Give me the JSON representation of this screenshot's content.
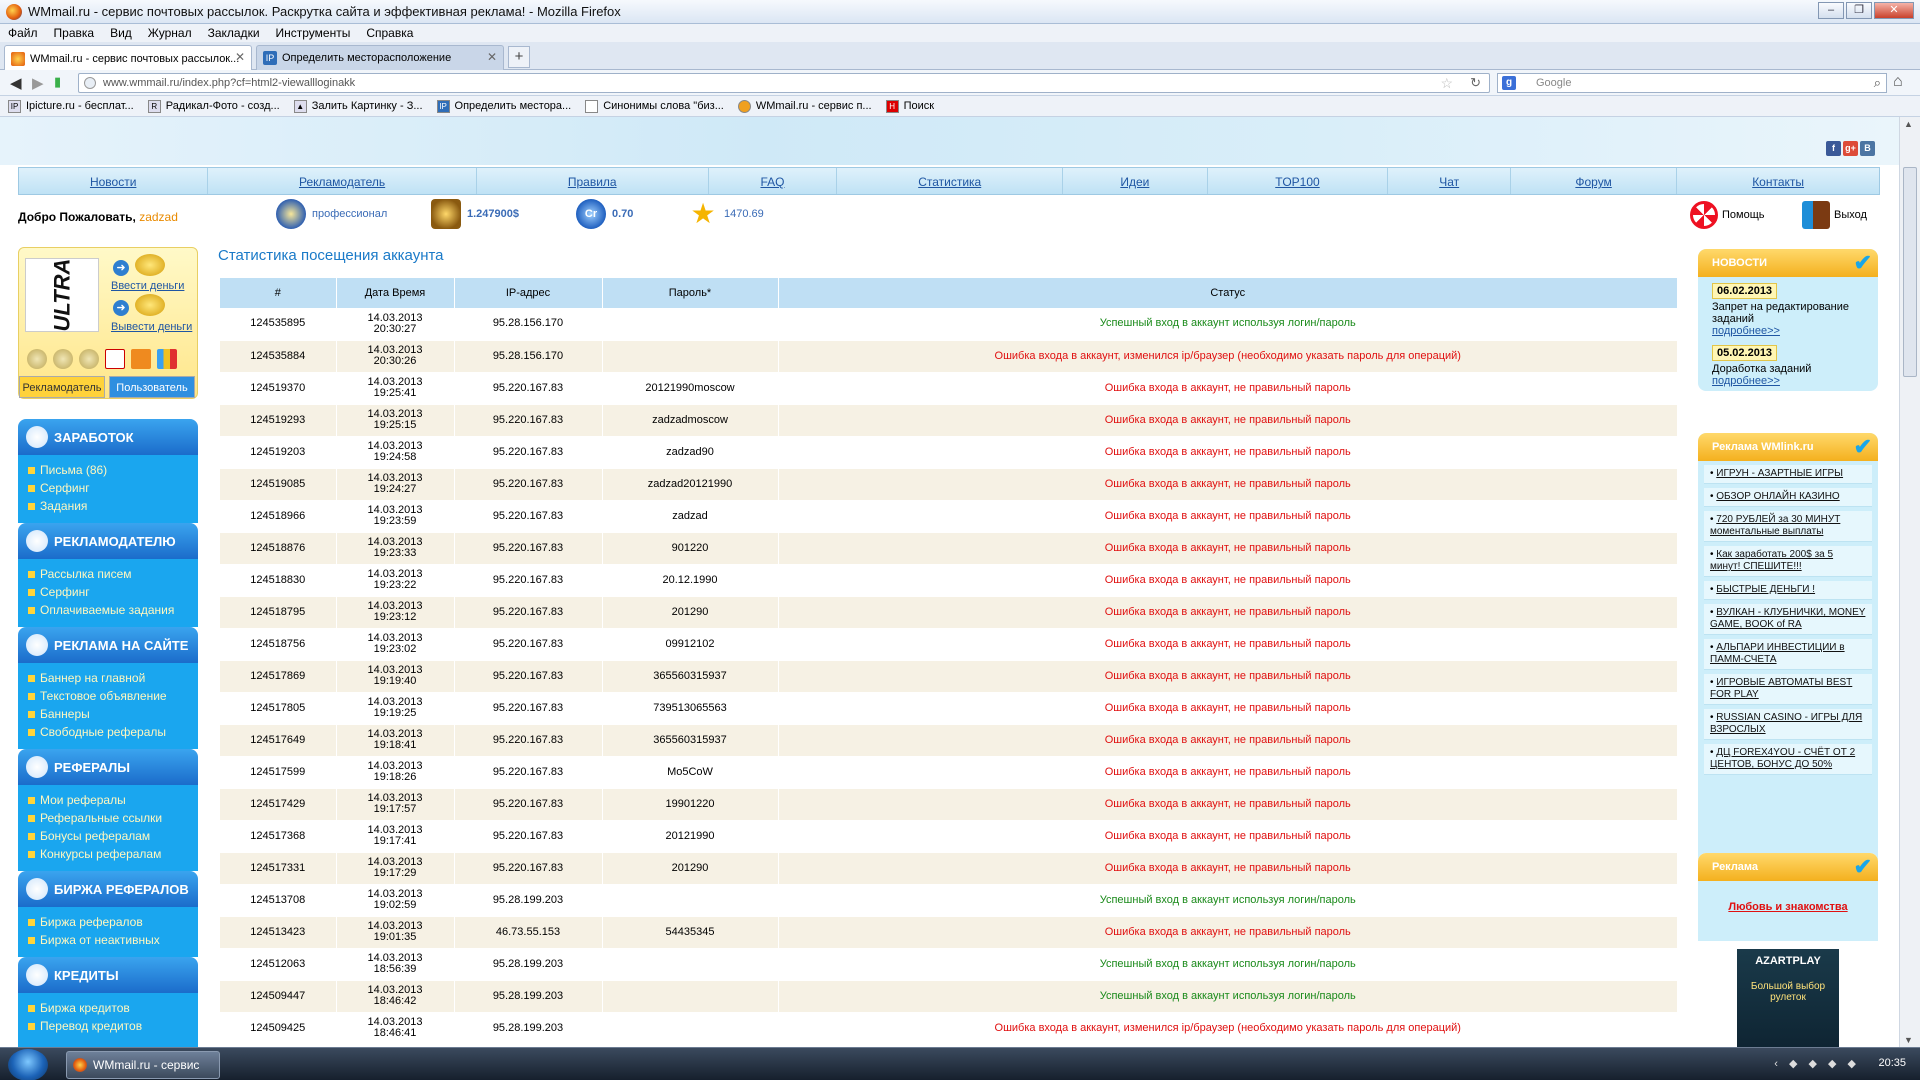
{
  "browser": {
    "title": "WMmail.ru - сервис почтовых рассылок. Раскрутка сайта и эффективная реклама! - Mozilla Firefox",
    "menu": [
      "Файл",
      "Правка",
      "Вид",
      "Журнал",
      "Закладки",
      "Инструменты",
      "Справка"
    ],
    "tabs": [
      {
        "label": "WMmail.ru - сервис почтовых рассылок..."
      },
      {
        "label": "Определить месторасположение"
      }
    ],
    "url": "www.wmmail.ru/index.php?cf=html2-viewallloginakk",
    "search_placeholder": "Google",
    "bookmarks": [
      "Ipicture.ru - бесплат...",
      "Радикал-Фото - созд...",
      "Залить Картинку - З...",
      "Определить месторa...",
      "Синонимы слова \"биз...",
      "WMmail.ru - сервис п...",
      "Поиск"
    ]
  },
  "site": {
    "nav": [
      "Новости",
      "Рекламодатель",
      "Правила",
      "FAQ",
      "Статистика",
      "Идеи",
      "TOP100",
      "Чат",
      "Форум",
      "Контакты"
    ],
    "welcome_label": "Добро Пожаловать,",
    "username": "zadzad",
    "status_level": "профессионал",
    "balance": "1.247900$",
    "credits": "0.70",
    "rating": "1470.69",
    "help_label": "Помощь",
    "exit_label": "Выход",
    "page_title": "Статистика посещения аккаунта",
    "userbox": {
      "logo_text": "ULTRA",
      "deposit_label": "Ввести деньги",
      "withdraw_label": "Вывести деньги",
      "role_advertiser": "Рекламодатель",
      "role_user": "Пользователь"
    },
    "sidebar": [
      {
        "title": "ЗАРАБОТОК",
        "items": [
          "Письма (86)",
          "Серфинг",
          "Задания"
        ]
      },
      {
        "title": "РЕКЛАМОДАТЕЛЮ",
        "items": [
          "Рассылка писем",
          "Серфинг",
          "Оплачиваемые задания"
        ]
      },
      {
        "title": "РЕКЛАМА НА САЙТЕ",
        "items": [
          "Баннер на главной",
          "Текстовое объявление",
          "Баннеры",
          "Свободные рефералы"
        ]
      },
      {
        "title": "РЕФЕРАЛЫ",
        "items": [
          "Мои рефералы",
          "Реферальные ссылки",
          "Бонусы рефералам",
          "Конкурсы рефералам"
        ]
      },
      {
        "title": "БИРЖА РЕФЕРАЛОВ",
        "items": [
          "Биржа рефералов",
          "Биржа от неактивных"
        ]
      },
      {
        "title": "КРЕДИТЫ",
        "items": [
          "Биржа кредитов",
          "Перевод кредитов"
        ]
      }
    ],
    "table": {
      "headers": [
        "#",
        "Дата Время",
        "IP-адрес",
        "Пароль*",
        "Статус"
      ],
      "rows": [
        {
          "id": "124535895",
          "date": "14.03.2013",
          "time": "20:30:27",
          "ip": "95.28.156.170",
          "pass": "",
          "status": "Успешный вход в аккаунт используя логин/пароль",
          "ok": true
        },
        {
          "id": "124535884",
          "date": "14.03.2013",
          "time": "20:30:26",
          "ip": "95.28.156.170",
          "pass": "",
          "status": "Ошибка входа в аккаунт, изменился ip/браузер (необходимо указать пароль для операций)",
          "ok": false
        },
        {
          "id": "124519370",
          "date": "14.03.2013",
          "time": "19:25:41",
          "ip": "95.220.167.83",
          "pass": "20121990moscow",
          "status": "Ошибка входа в аккаунт, не правильный пароль",
          "ok": false
        },
        {
          "id": "124519293",
          "date": "14.03.2013",
          "time": "19:25:15",
          "ip": "95.220.167.83",
          "pass": "zadzadmoscow",
          "status": "Ошибка входа в аккаунт, не правильный пароль",
          "ok": false
        },
        {
          "id": "124519203",
          "date": "14.03.2013",
          "time": "19:24:58",
          "ip": "95.220.167.83",
          "pass": "zadzad90",
          "status": "Ошибка входа в аккаунт, не правильный пароль",
          "ok": false
        },
        {
          "id": "124519085",
          "date": "14.03.2013",
          "time": "19:24:27",
          "ip": "95.220.167.83",
          "pass": "zadzad20121990",
          "status": "Ошибка входа в аккаунт, не правильный пароль",
          "ok": false
        },
        {
          "id": "124518966",
          "date": "14.03.2013",
          "time": "19:23:59",
          "ip": "95.220.167.83",
          "pass": "zadzad",
          "status": "Ошибка входа в аккаунт, не правильный пароль",
          "ok": false
        },
        {
          "id": "124518876",
          "date": "14.03.2013",
          "time": "19:23:33",
          "ip": "95.220.167.83",
          "pass": "901220",
          "status": "Ошибка входа в аккаунт, не правильный пароль",
          "ok": false
        },
        {
          "id": "124518830",
          "date": "14.03.2013",
          "time": "19:23:22",
          "ip": "95.220.167.83",
          "pass": "20.12.1990",
          "status": "Ошибка входа в аккаунт, не правильный пароль",
          "ok": false
        },
        {
          "id": "124518795",
          "date": "14.03.2013",
          "time": "19:23:12",
          "ip": "95.220.167.83",
          "pass": "201290",
          "status": "Ошибка входа в аккаунт, не правильный пароль",
          "ok": false
        },
        {
          "id": "124518756",
          "date": "14.03.2013",
          "time": "19:23:02",
          "ip": "95.220.167.83",
          "pass": "09912102",
          "status": "Ошибка входа в аккаунт, не правильный пароль",
          "ok": false
        },
        {
          "id": "124517869",
          "date": "14.03.2013",
          "time": "19:19:40",
          "ip": "95.220.167.83",
          "pass": "365560315937",
          "status": "Ошибка входа в аккаунт, не правильный пароль",
          "ok": false
        },
        {
          "id": "124517805",
          "date": "14.03.2013",
          "time": "19:19:25",
          "ip": "95.220.167.83",
          "pass": "739513065563",
          "status": "Ошибка входа в аккаунт, не правильный пароль",
          "ok": false
        },
        {
          "id": "124517649",
          "date": "14.03.2013",
          "time": "19:18:41",
          "ip": "95.220.167.83",
          "pass": "365560315937",
          "status": "Ошибка входа в аккаунт, не правильный пароль",
          "ok": false
        },
        {
          "id": "124517599",
          "date": "14.03.2013",
          "time": "19:18:26",
          "ip": "95.220.167.83",
          "pass": "Mo5CoW",
          "status": "Ошибка входа в аккаунт, не правильный пароль",
          "ok": false
        },
        {
          "id": "124517429",
          "date": "14.03.2013",
          "time": "19:17:57",
          "ip": "95.220.167.83",
          "pass": "19901220",
          "status": "Ошибка входа в аккаунт, не правильный пароль",
          "ok": false
        },
        {
          "id": "124517368",
          "date": "14.03.2013",
          "time": "19:17:41",
          "ip": "95.220.167.83",
          "pass": "20121990",
          "status": "Ошибка входа в аккаунт, не правильный пароль",
          "ok": false
        },
        {
          "id": "124517331",
          "date": "14.03.2013",
          "time": "19:17:29",
          "ip": "95.220.167.83",
          "pass": "201290",
          "status": "Ошибка входа в аккаунт, не правильный пароль",
          "ok": false
        },
        {
          "id": "124513708",
          "date": "14.03.2013",
          "time": "19:02:59",
          "ip": "95.28.199.203",
          "pass": "",
          "status": "Успешный вход в аккаунт используя логин/пароль",
          "ok": true
        },
        {
          "id": "124513423",
          "date": "14.03.2013",
          "time": "19:01:35",
          "ip": "46.73.55.153",
          "pass": "54435345",
          "status": "Ошибка входа в аккаунт, не правильный пароль",
          "ok": false
        },
        {
          "id": "124512063",
          "date": "14.03.2013",
          "time": "18:56:39",
          "ip": "95.28.199.203",
          "pass": "",
          "status": "Успешный вход в аккаунт используя логин/пароль",
          "ok": true
        },
        {
          "id": "124509447",
          "date": "14.03.2013",
          "time": "18:46:42",
          "ip": "95.28.199.203",
          "pass": "",
          "status": "Успешный вход в аккаунт используя логин/пароль",
          "ok": true
        },
        {
          "id": "124509425",
          "date": "14.03.2013",
          "time": "18:46:41",
          "ip": "95.28.199.203",
          "pass": "",
          "status": "Ошибка входа в аккаунт, изменился ip/браузер (необходимо указать пароль для операций)",
          "ok": false
        }
      ]
    },
    "news": {
      "title": "НОВОСТИ",
      "items": [
        {
          "date": "06.02.2013",
          "text": "Запрет на редактирование заданий",
          "more": "подробнее>>"
        },
        {
          "date": "05.02.2013",
          "text": "Доработка заданий",
          "more": "подробнее>>"
        }
      ]
    },
    "wmlink": {
      "title": "Реклама WMlink.ru",
      "items": [
        "ИГРУН - АЗАРТНЫЕ ИГРЫ",
        "ОБЗОР ОНЛАЙН КАЗИНО",
        "720 РУБЛЕЙ за 30 МИНУТ моментальные выплаты",
        "Как заработать 200$ за 5 минут! СПЕШИТЕ!!!",
        "БЫСТРЫЕ ДЕНЬГИ !",
        "ВУЛКАН - КЛУБНИЧКИ, MONEY GAME, BOOK of RA",
        "АЛЬПАРИ ИНВЕСТИЦИИ в ПАММ-СЧЕТА",
        "ИГРОВЫЕ АВТОМАТЫ BEST FOR PLAY",
        "RUSSIAN CASINO - ИГРЫ ДЛЯ ВЗРОСЛЫХ",
        "ДЦ FOREX4YOU - СЧЁТ ОТ 2 ЦЕНТОВ, БОНУС ДО 50%"
      ]
    },
    "ads": {
      "title": "Реклама",
      "link": "Любовь и знакомства",
      "banner_brand": "AZARTPLAY",
      "banner_text": "Большой выбор рулеток"
    }
  },
  "taskbar": {
    "app": "WMmail.ru - сервис п...",
    "clock": "20:35"
  }
}
